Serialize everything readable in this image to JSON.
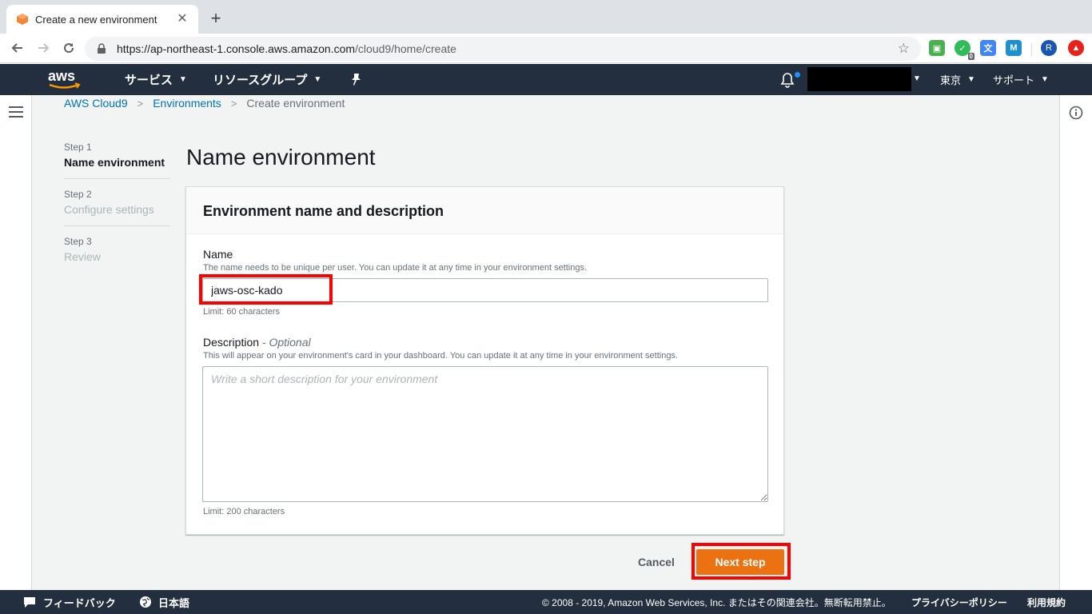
{
  "browser": {
    "tab_title": "Create a new environment",
    "url_host": "https://ap-northeast-1.console.aws.amazon.com",
    "url_path": "/cloud9/home/create",
    "ext_badge": "0",
    "avatar_letter": "R"
  },
  "aws_nav": {
    "services": "サービス",
    "resource_groups": "リソースグループ",
    "region": "東京",
    "support": "サポート"
  },
  "breadcrumb": {
    "item1": "AWS Cloud9",
    "item2": "Environments",
    "item3": "Create environment"
  },
  "steps": [
    {
      "num": "Step 1",
      "label": "Name environment"
    },
    {
      "num": "Step 2",
      "label": "Configure settings"
    },
    {
      "num": "Step 3",
      "label": "Review"
    }
  ],
  "page_title": "Name environment",
  "panel": {
    "title": "Environment name and description",
    "name_label": "Name",
    "name_hint": "The name needs to be unique per user. You can update it at any time in your environment settings.",
    "name_value": "jaws-osc-kado",
    "name_limit": "Limit: 60 characters",
    "desc_label": "Description",
    "desc_optional": "- Optional",
    "desc_hint": "This will appear on your environment's card in your dashboard. You can update it at any time in your environment settings.",
    "desc_placeholder": "Write a short description for your environment",
    "desc_limit": "Limit: 200 characters"
  },
  "actions": {
    "cancel": "Cancel",
    "next": "Next step"
  },
  "footer": {
    "feedback": "フィードバック",
    "language": "日本語",
    "copyright": "© 2008 - 2019, Amazon Web Services, Inc. またはその関連会社。無断転用禁止。",
    "privacy": "プライバシーポリシー",
    "terms": "利用規約"
  },
  "colors": {
    "aws_nav": "#232f3e",
    "primary_button": "#ec7211",
    "link": "#0073bb",
    "annotation": "#ff0000"
  }
}
